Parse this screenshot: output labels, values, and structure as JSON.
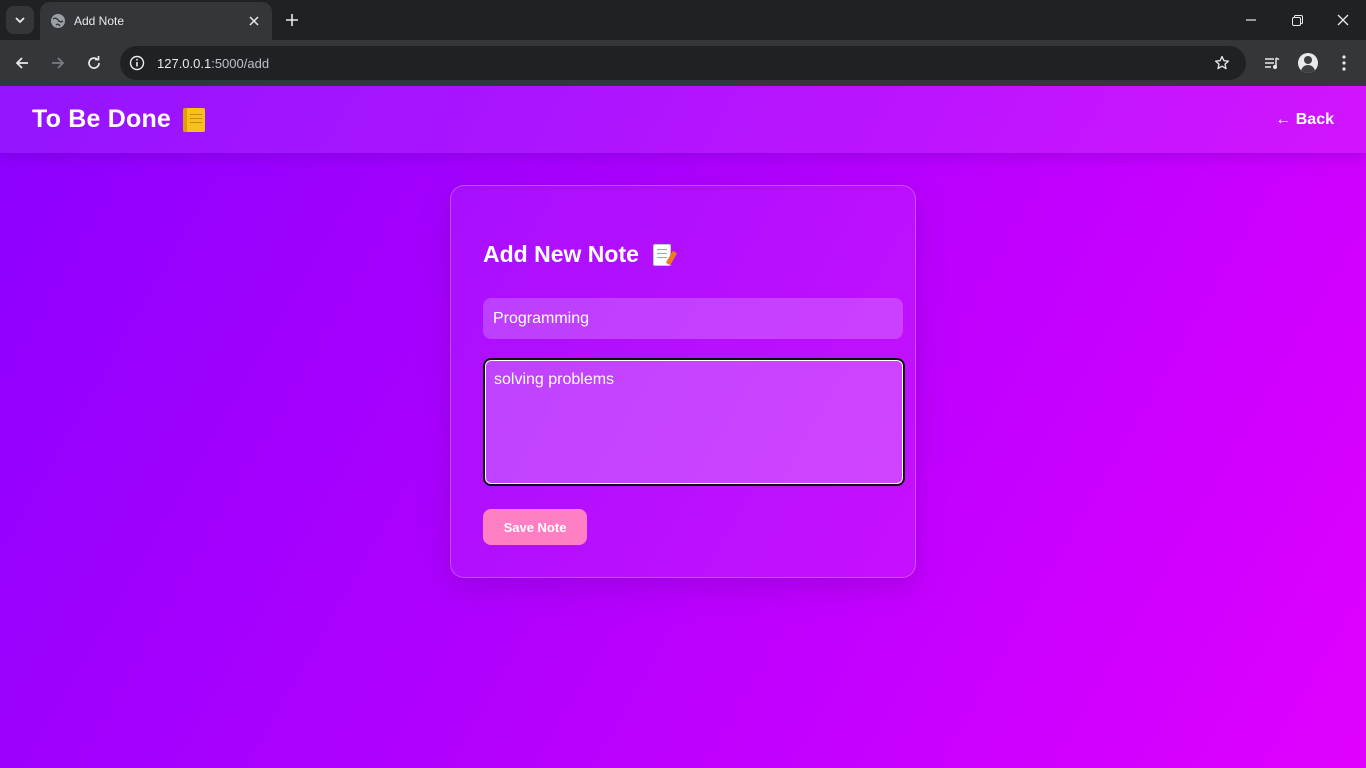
{
  "browser": {
    "tab_title": "Add Note",
    "url_host": "127.0.0.1",
    "url_path": ":5000/add",
    "icons": [
      "tab-list-icon",
      "globe-icon",
      "close-icon",
      "plus-icon",
      "minimize-icon",
      "restore-icon",
      "close-window-icon",
      "back-arrow-icon",
      "forward-arrow-icon",
      "reload-icon",
      "site-info-icon",
      "star-icon",
      "media-icon",
      "profile-avatar",
      "more-vert-icon"
    ]
  },
  "header": {
    "brand": "To Be Done",
    "brand_icon": "notebook-icon",
    "back_label": "← Back"
  },
  "form": {
    "heading": "Add New Note",
    "heading_icon": "memo-icon",
    "title_value": "Programming",
    "content_value": "solving problems",
    "save_label": "Save Note"
  },
  "colors": {
    "gradient_start": "#8b00ff",
    "gradient_end": "#e000ff",
    "button": "#ff7fc4"
  }
}
